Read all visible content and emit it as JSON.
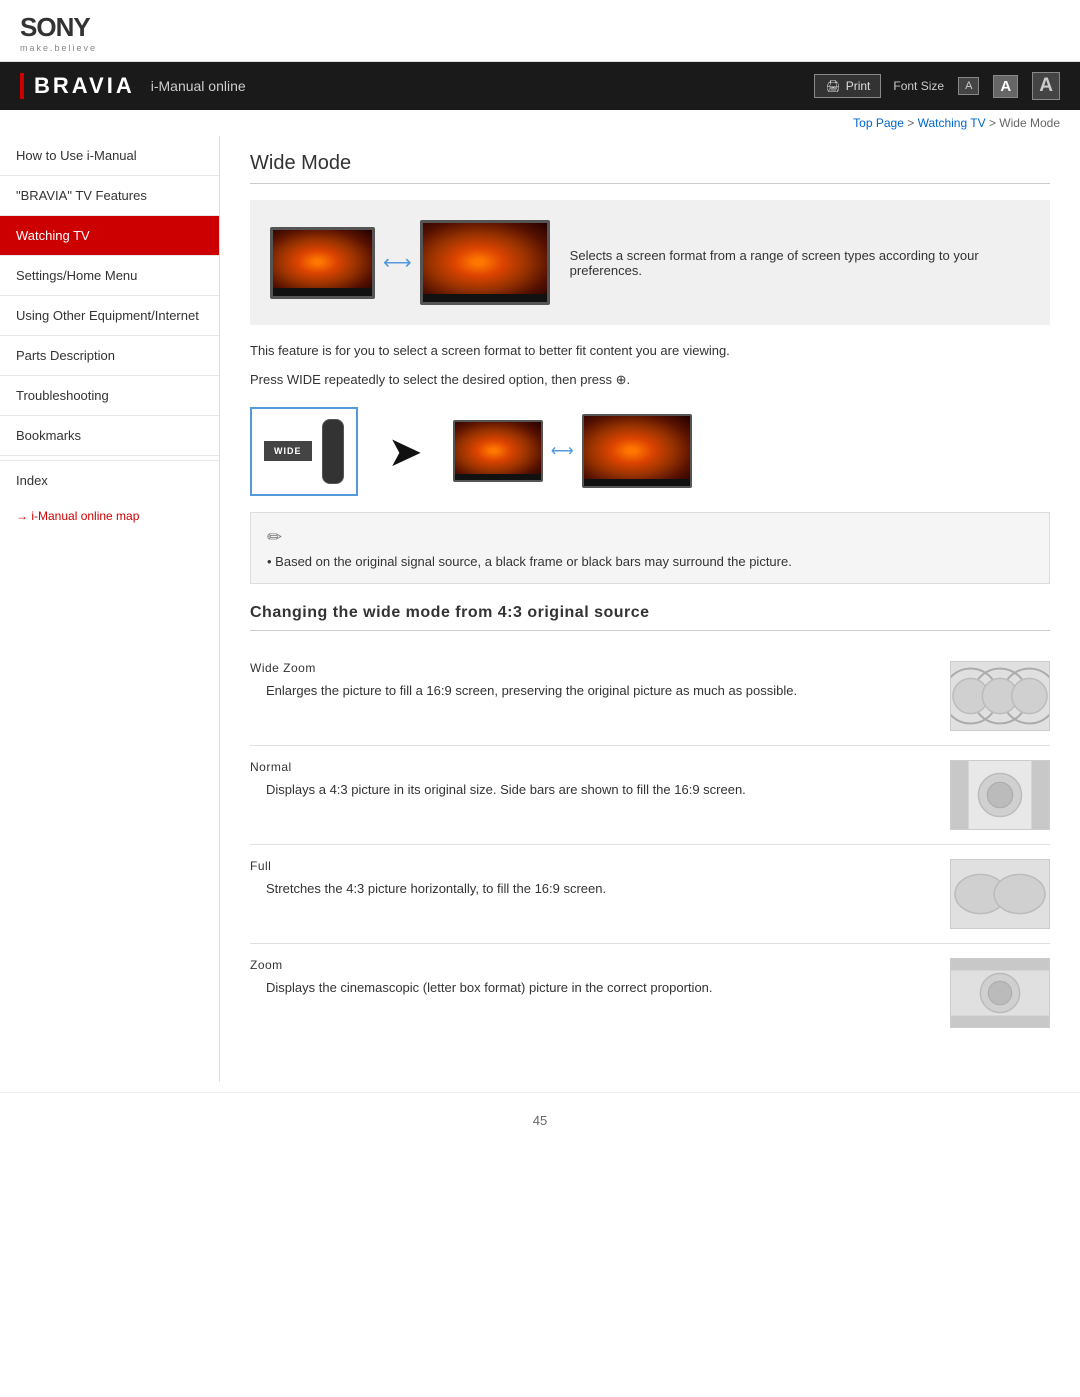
{
  "header": {
    "sony_logo": "SONY",
    "sony_tagline": "make.believe",
    "bravia_logo": "BRAVIA",
    "nav_title": "i-Manual online",
    "print_label": "Print",
    "font_size_label": "Font Size",
    "font_small": "A",
    "font_medium": "A",
    "font_large": "A"
  },
  "breadcrumb": {
    "top_page": "Top Page",
    "watching_tv": "Watching TV",
    "current": "Wide Mode"
  },
  "sidebar": {
    "items": [
      {
        "id": "how-to-use",
        "label": "How to Use i-Manual",
        "active": false
      },
      {
        "id": "bravia-features",
        "label": "\"BRAVIA\" TV Features",
        "active": false
      },
      {
        "id": "watching-tv",
        "label": "Watching TV",
        "active": true
      },
      {
        "id": "settings",
        "label": "Settings/Home Menu",
        "active": false
      },
      {
        "id": "using-other",
        "label": "Using Other Equipment/Internet",
        "active": false
      },
      {
        "id": "parts",
        "label": "Parts Description",
        "active": false
      },
      {
        "id": "troubleshooting",
        "label": "Troubleshooting",
        "active": false
      },
      {
        "id": "bookmarks",
        "label": "Bookmarks",
        "active": false
      }
    ],
    "index_label": "Index",
    "map_link": "i-Manual online map"
  },
  "content": {
    "page_title": "Wide Mode",
    "image_desc": "Selects a screen format from a range of screen types according to your preferences.",
    "body_text1": "This feature is for you to select a screen format to better fit content you are viewing.",
    "body_text2": "Press WIDE repeatedly to select the desired option, then press ⊕.",
    "note_text": "Based on the original signal source, a black frame or black bars may surround the picture.",
    "section_title": "Changing the wide mode from 4:3 original source",
    "modes": [
      {
        "name": "Wide Zoom",
        "desc": "Enlarges the picture to fill a 16:9 screen, preserving the original picture as much as possible.",
        "image_type": "wide-zoom"
      },
      {
        "name": "Normal",
        "desc": "Displays a 4:3 picture in its original size. Side bars are shown to fill the 16:9 screen.",
        "image_type": "normal"
      },
      {
        "name": "Full",
        "desc": "Stretches the 4:3 picture horizontally, to fill the 16:9 screen.",
        "image_type": "full"
      },
      {
        "name": "Zoom",
        "desc": "Displays the cinemascopic (letter box format) picture in the correct proportion.",
        "image_type": "zoom"
      }
    ],
    "page_number": "45"
  }
}
